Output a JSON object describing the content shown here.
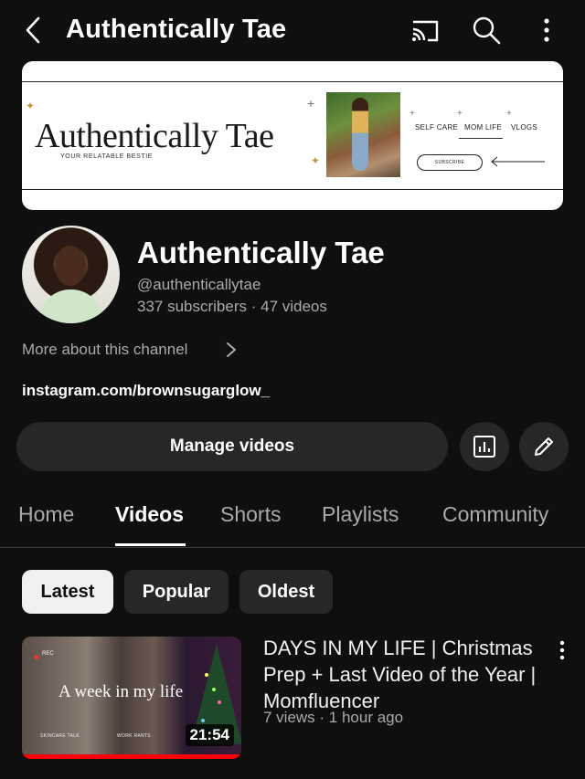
{
  "header": {
    "title": "Authentically Tae",
    "icons": [
      "back-arrow-icon",
      "cast-icon",
      "search-icon",
      "more-vert-icon"
    ]
  },
  "banner": {
    "script_title": "Authentically Tae",
    "tagline": "YOUR RELATABLE BESTIE",
    "nav": [
      "SELF CARE",
      "MOM LIFE",
      "VLOGS"
    ],
    "subscribe": "SUBSCRIBE"
  },
  "channel": {
    "name": "Authentically Tae",
    "handle": "@authenticallytae",
    "stats": "337 subscribers · 47 videos",
    "more_about": "More about this channel",
    "link": "instagram.com/brownsugarglow_"
  },
  "actions": {
    "manage_videos": "Manage videos"
  },
  "tabs": [
    "Home",
    "Videos",
    "Shorts",
    "Playlists",
    "Community"
  ],
  "active_tab": "Videos",
  "filters": [
    "Latest",
    "Popular",
    "Oldest"
  ],
  "active_filter": "Latest",
  "video": {
    "title": "DAYS IN MY LIFE | Christmas Prep + Last Video of the Year | Momfluencer",
    "meta": "7 views · 1 hour ago",
    "duration": "21:54",
    "thumb_overlay": "A week in my life",
    "thumb_rec": "REC",
    "thumb_label_left": "SKINCARE TALK",
    "thumb_label_mid": "WORK RANTS",
    "watch_progress": 1.0
  },
  "colors": {
    "background": "#0f0f0f",
    "surface": "#272727",
    "text_secondary": "#aaaaaa",
    "progress": "#ff0000",
    "banner_accent": "#c9953c"
  }
}
